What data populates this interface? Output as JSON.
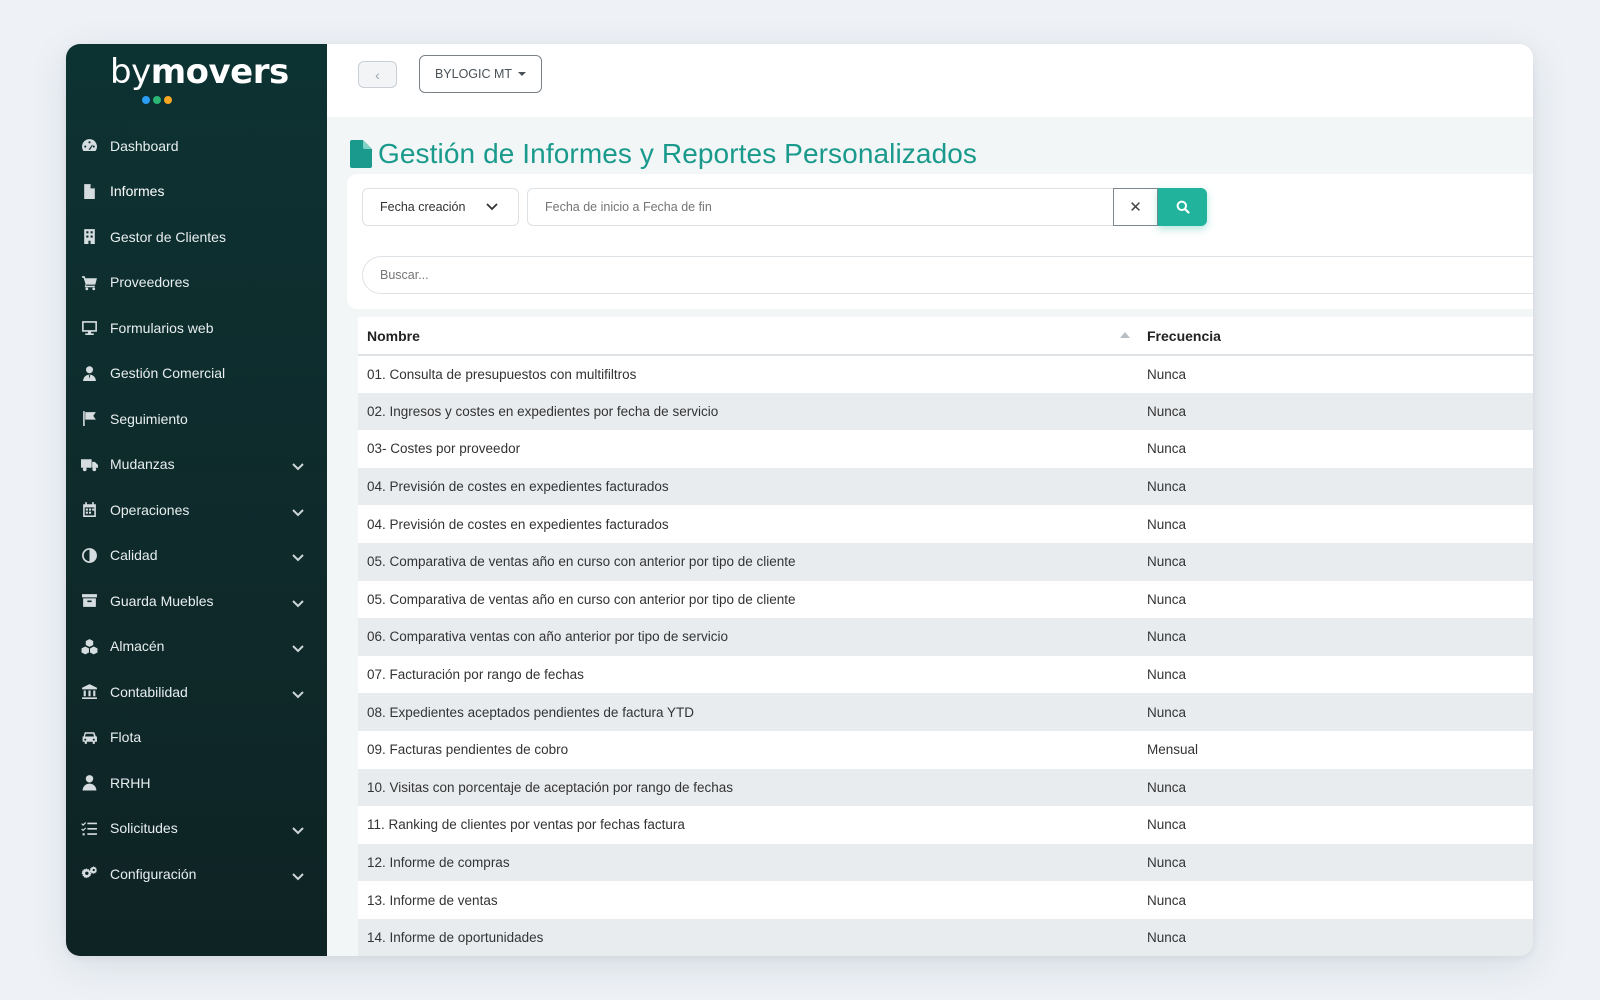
{
  "brand": {
    "logo_prefix": "by",
    "logo_name": "movers",
    "dot_colors": [
      "#2a9df4",
      "#2bb673",
      "#f5a623"
    ]
  },
  "colors": {
    "sidebar": "#0f2a2b",
    "accent": "#22b39c",
    "title": "#1a9a8c"
  },
  "sidebar": {
    "items": [
      {
        "label": "Dashboard",
        "icon": "tachometer-icon",
        "expandable": false,
        "active": false
      },
      {
        "label": "Informes",
        "icon": "file-icon",
        "expandable": false,
        "active": true
      },
      {
        "label": "Gestor de Clientes",
        "icon": "building-icon",
        "expandable": false,
        "active": false
      },
      {
        "label": "Proveedores",
        "icon": "cart-icon",
        "expandable": false,
        "active": false
      },
      {
        "label": "Formularios web",
        "icon": "monitor-icon",
        "expandable": false,
        "active": false
      },
      {
        "label": "Gestión Comercial",
        "icon": "user-tie-icon",
        "expandable": false,
        "active": false
      },
      {
        "label": "Seguimiento",
        "icon": "flag-icon",
        "expandable": false,
        "active": false
      },
      {
        "label": "Mudanzas",
        "icon": "truck-icon",
        "expandable": true,
        "active": false
      },
      {
        "label": "Operaciones",
        "icon": "calendar-icon",
        "expandable": true,
        "active": false
      },
      {
        "label": "Calidad",
        "icon": "half-circle-icon",
        "expandable": true,
        "active": false
      },
      {
        "label": "Guarda Muebles",
        "icon": "archive-icon",
        "expandable": true,
        "active": false
      },
      {
        "label": "Almacén",
        "icon": "cubes-icon",
        "expandable": true,
        "active": false
      },
      {
        "label": "Contabilidad",
        "icon": "bank-icon",
        "expandable": true,
        "active": false
      },
      {
        "label": "Flota",
        "icon": "car-icon",
        "expandable": false,
        "active": false
      },
      {
        "label": "RRHH",
        "icon": "user-icon",
        "expandable": false,
        "active": false
      },
      {
        "label": "Solicitudes",
        "icon": "list-check-icon",
        "expandable": true,
        "active": false
      },
      {
        "label": "Configuración",
        "icon": "gears-icon",
        "expandable": true,
        "active": false
      }
    ]
  },
  "topbar": {
    "company_label": "BYLOGIC MT"
  },
  "page": {
    "title": "Gestión de Informes y Reportes Personalizados"
  },
  "filters": {
    "date_type": "Fecha creación",
    "date_range_placeholder": "Fecha de inicio a Fecha de fin",
    "search_placeholder": "Buscar..."
  },
  "table": {
    "columns": [
      "Nombre",
      "Frecuencia"
    ],
    "rows": [
      [
        "01. Consulta de presupuestos con multifiltros",
        "Nunca"
      ],
      [
        "02. Ingresos y costes en expedientes por fecha de servicio",
        "Nunca"
      ],
      [
        "03- Costes por proveedor",
        "Nunca"
      ],
      [
        "04. Previsión de costes en expedientes facturados",
        "Nunca"
      ],
      [
        "04. Previsión de costes en expedientes facturados",
        "Nunca"
      ],
      [
        "05. Comparativa de ventas año en curso con anterior por tipo de cliente",
        "Nunca"
      ],
      [
        "05. Comparativa de ventas año en curso con anterior por tipo de cliente",
        "Nunca"
      ],
      [
        "06. Comparativa ventas con año anterior por tipo de servicio",
        "Nunca"
      ],
      [
        "07. Facturación por rango de fechas",
        "Nunca"
      ],
      [
        "08. Expedientes aceptados pendientes de factura YTD",
        "Nunca"
      ],
      [
        "09. Facturas pendientes de cobro",
        "Mensual"
      ],
      [
        "10. Visitas con porcentaje de aceptación por rango de fechas",
        "Nunca"
      ],
      [
        "11. Ranking de clientes por ventas por fechas factura",
        "Nunca"
      ],
      [
        "12. Informe de compras",
        "Nunca"
      ],
      [
        "13. Informe de ventas",
        "Nunca"
      ],
      [
        "14. Informe de oportunidades",
        "Nunca"
      ]
    ]
  }
}
